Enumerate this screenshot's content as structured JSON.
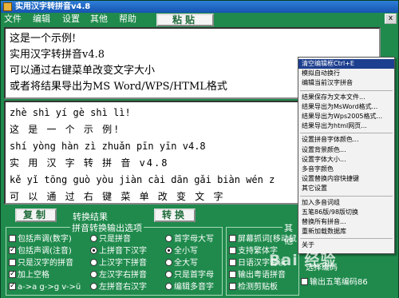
{
  "window": {
    "title": "实用汉字转拼音v4.8"
  },
  "menu": [
    "文件",
    "编辑",
    "设置",
    "其他",
    "帮助"
  ],
  "toolbar": {
    "paste_label": "粘贴",
    "close_label": "x"
  },
  "input": {
    "lines": [
      "这是一个示例!",
      "实用汉字转拼音v4.8",
      "可以通过右键菜单改变文字大小",
      "或者将结果导出为MS Word/WPS/HTML格式"
    ]
  },
  "output": {
    "lines": [
      "zhè shì yí gè shì lì!",
      "这  是  一  个  示  例!",
      "shí yòng hàn zì zhuǎn pīn yīn v4.8",
      "实  用  汉  字  转  拼  音  v4.8",
      "kě yǐ tōng guò yòu jiàn cài dān gǎi biàn wén z",
      "可  以  通  过  右  键  菜  单  改  变  文  字"
    ]
  },
  "controls": {
    "copy_label": "复制",
    "result_label": "转换结果",
    "convert_label": "转换",
    "group1_title": "拼音转换输出选项",
    "group2_title": "其他",
    "options_col1": [
      {
        "label": "包括声调(数字)",
        "checked": false
      },
      {
        "label": "包括声调(注音)",
        "checked": true
      },
      {
        "label": "只是汉字的拼音",
        "checked": false
      },
      {
        "label": "加上空格",
        "checked": true
      },
      {
        "label": "a->a g->g v->ü",
        "checked": true
      }
    ],
    "options_col2": [
      {
        "label": "只是拼音",
        "checked": false
      },
      {
        "label": "上拼音下汉字",
        "checked": true
      },
      {
        "label": "上汉字下拼音",
        "checked": false
      },
      {
        "label": "左汉字右拼音",
        "checked": false
      },
      {
        "label": "左拼音右汉字",
        "checked": false
      }
    ],
    "options_col3": [
      {
        "label": "首字母大写",
        "checked": false
      },
      {
        "label": "全小写",
        "checked": true
      },
      {
        "label": "全大写",
        "checked": false
      },
      {
        "label": "只是首字母",
        "checked": false
      },
      {
        "label": "编辑多音字",
        "checked": false
      }
    ],
    "options_col4": [
      {
        "label": "屏幕抓词[移动鼠",
        "checked": false
      },
      {
        "label": "支持繁体字",
        "checked": false
      },
      {
        "label": "日语汉字音读",
        "checked": false
      },
      {
        "label": "输出粤语拼音",
        "checked": false
      },
      {
        "label": "检测剪贴板",
        "checked": false
      }
    ],
    "extra_label": "输出五笔编码86",
    "extra2_label": "选择编码"
  },
  "context_menu": {
    "items": [
      {
        "label": "清空编辑框Ctrl+E",
        "selected": true
      },
      {
        "label": "模拟自动换行",
        "selected": false
      },
      {
        "label": "编辑当前汉字拼音",
        "selected": false
      },
      {
        "sep": true
      },
      {
        "label": "结果保存为文本文件...",
        "selected": false
      },
      {
        "label": "结果导出为MsWord格式...",
        "selected": false
      },
      {
        "label": "结果导出为Wps2005格式...",
        "selected": false
      },
      {
        "label": "结果导出为html网页...",
        "selected": false
      },
      {
        "sep": true
      },
      {
        "label": "设置拼音字体颜色...",
        "selected": false
      },
      {
        "label": "设置背景颜色...",
        "selected": false
      },
      {
        "label": "设置字体大小...",
        "selected": false
      },
      {
        "label": "多音字颜色",
        "selected": false
      },
      {
        "label": "设置替换内容快捷键",
        "selected": false
      },
      {
        "label": "其它设置",
        "selected": false
      },
      {
        "sep": true
      },
      {
        "label": "加入多音词组",
        "selected": false
      },
      {
        "label": "五笔86版/98版切换",
        "selected": false
      },
      {
        "label": "替换所有拼音...",
        "selected": false
      },
      {
        "label": "重新加载数据库",
        "selected": false
      },
      {
        "sep": true
      },
      {
        "label": "关于",
        "selected": false
      }
    ]
  },
  "watermark": "Bai 经验",
  "colors": {
    "window_bg": "#1f8a4c",
    "title_bar": "#1554b0",
    "menu_highlight": "#1d3f8f"
  }
}
